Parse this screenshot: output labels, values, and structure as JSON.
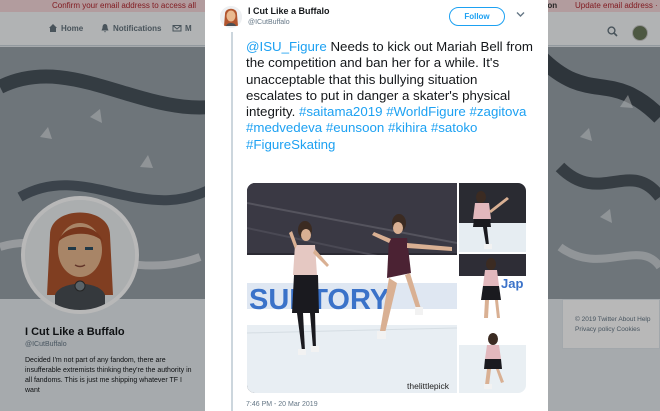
{
  "background": {
    "banner": {
      "left_text": "Confirm your email address to access all",
      "button_text": "ation",
      "right_text": "Update email address · Learn"
    },
    "nav": {
      "home": "Home",
      "notifications": "Notifications",
      "messages": "M"
    },
    "profile": {
      "name": "I Cut Like a Buffalo",
      "handle": "@ICutBuffalo",
      "bio": "Decided I'm not part of any fandom, there are insufferable extremists thinking they're the authority in all fandoms. This is just me shipping whatever TF I want"
    },
    "footer": {
      "line1": "© 2019 Twitter   About   Help",
      "line2": "Privacy policy   Cookies"
    }
  },
  "tweet": {
    "author_name": "I Cut Like a Buffalo",
    "author_handle": "@ICutBuffalo",
    "follow_label": "Follow",
    "mention": "@ISU_Figure",
    "body": " Needs to kick out Mariah Bell from the competition and ban her for a while. It's unacceptable that this bullying situation escalates to put in danger a skater's physical integrity. ",
    "hashtags": [
      "#saitama2019",
      "#WorldFigure",
      "#zagitova",
      "#medvedeva",
      "#eunsoon",
      "#kihira",
      "#satoko",
      "#FigureSkating"
    ],
    "media": {
      "board_text": "SUNTORY",
      "board_text_small": "Jap",
      "watermark": "thelittlepick"
    },
    "timestamp": "7:46 PM - 20 Mar 2019"
  },
  "colors": {
    "accent": "#1da1f2",
    "text": "#14171a",
    "muted": "#657786"
  },
  "icons": {
    "home": "home-icon",
    "notifications": "bell-icon",
    "messages": "envelope-icon",
    "search": "search-icon",
    "caret": "chevron-down-icon"
  }
}
